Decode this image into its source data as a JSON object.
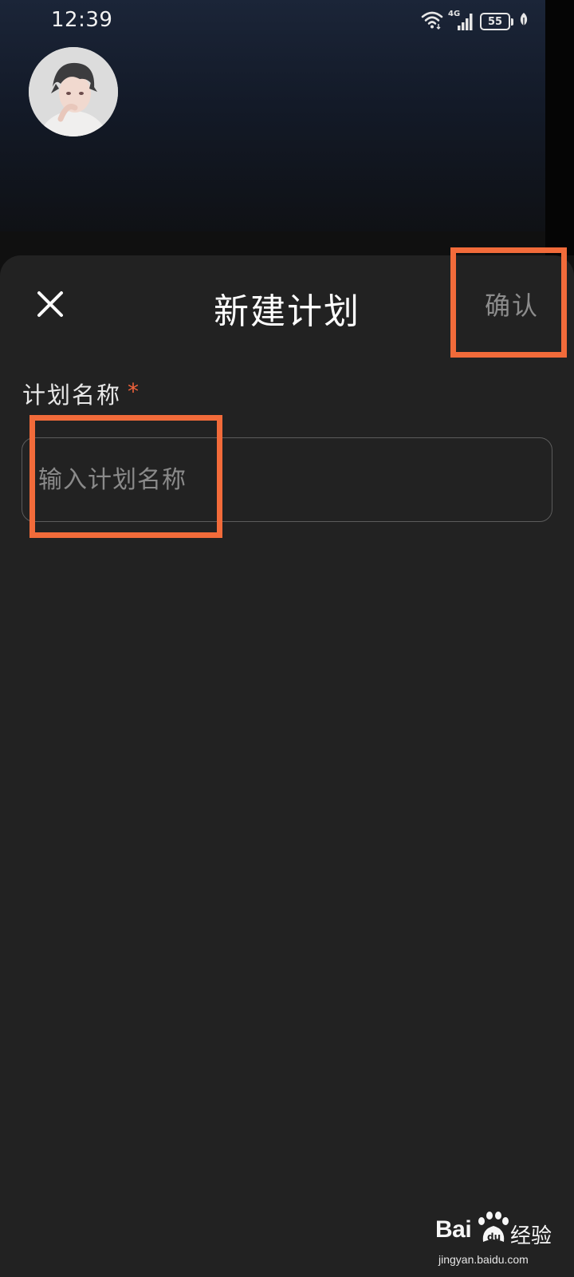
{
  "status_bar": {
    "time": "12:39",
    "network": "4G",
    "battery": "55",
    "icons": [
      "wifi-icon",
      "signal-icon",
      "battery-icon",
      "leaf-icon"
    ]
  },
  "profile": {
    "avatar": "avatar-illustration"
  },
  "sheet": {
    "title": "新建计划",
    "close_icon": "close-icon",
    "confirm_label": "确认"
  },
  "form": {
    "name_label": "计划名称",
    "required_mark": "*",
    "name_placeholder": "输入计划名称",
    "name_value": ""
  },
  "watermark": {
    "brand": "Bai",
    "product": "经验",
    "url": "jingyan.baidu.com"
  },
  "colors": {
    "sheet_background": "#222222",
    "highlight": "#f26b3a",
    "required": "#f0623b",
    "confirm_text": "#8c8c8c"
  }
}
